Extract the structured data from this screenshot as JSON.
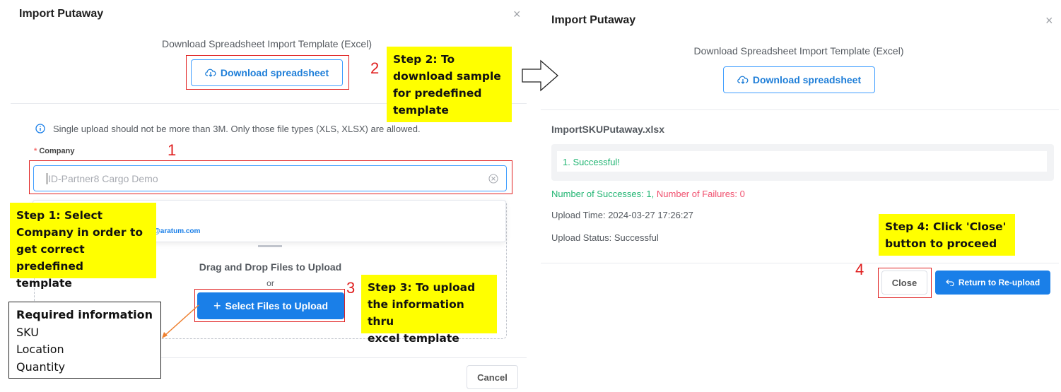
{
  "left": {
    "title": "Import Putaway",
    "close_glyph": "×",
    "download_heading": "Download Spreadsheet Import Template (Excel)",
    "download_button": "Download spreadsheet",
    "info_text": "Single upload should not be more than 3M. Only those file types (XLS, XLSX) are allowed.",
    "company_label": "Company",
    "required_mark": "*",
    "company_value": "ID-Partner8 Cargo Demo",
    "dropdown_email": "@aratum.com",
    "drag_text": "Drag and Drop Files to Upload",
    "or_text": "or",
    "select_button": "Select Files to Upload",
    "cancel_button": "Cancel"
  },
  "right": {
    "title": "Import Putaway",
    "close_glyph": "×",
    "download_heading": "Download Spreadsheet Import Template (Excel)",
    "download_button": "Download spreadsheet",
    "filename": "ImportSKUPutaway.xlsx",
    "result_line": "1. Successful!",
    "successes_label": "Number of Successes:",
    "successes_value": "1",
    "failures_label": "Number of Failures:",
    "failures_value": "0",
    "upload_time": "Upload Time: 2024-03-27 17:26:27",
    "upload_status": "Upload Status: Successful",
    "close_button": "Close",
    "reupload_button": "Return to Re-upload"
  },
  "annotations": {
    "num1": "1",
    "num2": "2",
    "num3": "3",
    "num4": "4",
    "step1": [
      "Step 1: Select",
      "Company in order to",
      "get correct predefined",
      "template"
    ],
    "step2": [
      "Step 2: To",
      "download sample",
      "for predefined",
      "template"
    ],
    "step3": [
      "Step 3: To upload",
      "the information thru",
      "excel template"
    ],
    "step4": [
      "Step 4: Click 'Close'",
      "button to proceed"
    ],
    "required": [
      "Required information",
      "SKU",
      "Location",
      "Quantity"
    ]
  },
  "colors": {
    "accent": "#1a7fe8",
    "highlight": "#ffff00",
    "annotation_red": "#e02020",
    "success_green": "#22b573",
    "failure_red": "#f0506e"
  },
  "icons": [
    "cloud-download-icon",
    "info-icon",
    "clear-icon",
    "plus-icon",
    "return-icon",
    "close-icon",
    "arrow-right-icon"
  ]
}
